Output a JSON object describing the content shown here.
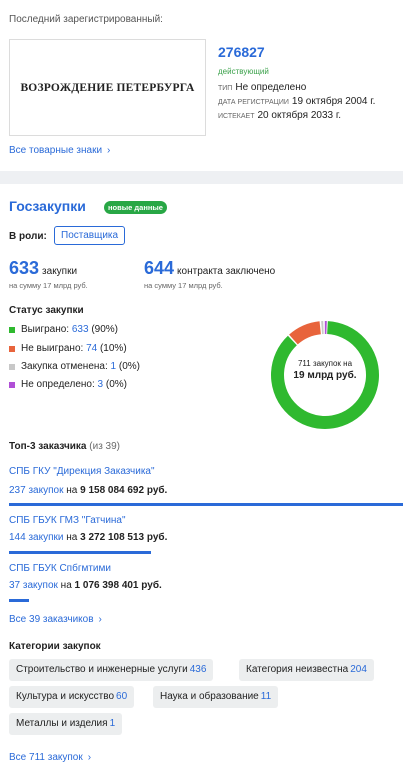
{
  "trademark": {
    "last_registered_label": "Последний зарегистрированный:",
    "image_text": "ВОЗРОЖДЕНИЕ ПЕТЕРБУРГА",
    "number": "276827",
    "status": "действующий",
    "type_label": "тип",
    "type_value": "Не определено",
    "reg_date_label": "дата регистрации",
    "reg_date_value": "19 октября 2004 г.",
    "expires_label": "истекает",
    "expires_value": "20 октября 2033 г.",
    "all_link": "Все товарные знаки",
    "chevron": "›"
  },
  "procurement": {
    "title": "Госзакупки",
    "new_badge": "новые данные",
    "role_label": "В роли:",
    "role_value": "Поставщика",
    "purchases_count": "633",
    "purchases_label": "закупки",
    "purchases_sum": "на сумму 17 млрд руб.",
    "contracts_count": "644",
    "contracts_label": "контракта заключено",
    "contracts_sum": "на сумму 17 млрд руб.",
    "status_title": "Статус закупки",
    "statuses": [
      {
        "label": "Выиграно:",
        "value": "633",
        "pct": "(90%)",
        "color": "#2fb92f",
        "count": 633
      },
      {
        "label": "Не выиграно:",
        "value": "74",
        "pct": "(10%)",
        "color": "#e8643c",
        "count": 74
      },
      {
        "label": "Закупка отменена:",
        "value": "1",
        "pct": "(0%)",
        "color": "#c8c8c8",
        "count": 1
      },
      {
        "label": "Не определено:",
        "value": "3",
        "pct": "(0%)",
        "color": "#b04fd6",
        "count": 3
      }
    ],
    "donut_line1": "711 закупок на",
    "donut_line2": "19 млрд руб.",
    "top3_title": "Топ-3 заказчика",
    "top3_of": "(из 39)",
    "customers": [
      {
        "name": "СПБ ГКУ \"Дирекция Заказчика\"",
        "count_text": "237 закупок",
        "on": "на",
        "sum": "9 158 084 692 руб.",
        "share": 1.0
      },
      {
        "name": "СПБ ГБУК ГМЗ \"Гатчина\"",
        "count_text": "144 закупки",
        "on": "на",
        "sum": "3 272 108 513 руб.",
        "share": 0.36
      },
      {
        "name": "СПБ ГБУК Спбгмтими",
        "count_text": "37 закупок",
        "on": "на",
        "sum": "1 076 398 401 руб.",
        "share": 0.05
      }
    ],
    "all_customers_link": "Все 39 заказчиков",
    "categories_title": "Категории закупок",
    "categories": [
      {
        "name": "Строительство и инженерные услуги",
        "count": "436"
      },
      {
        "name": "Категория неизвестна",
        "count": "204"
      },
      {
        "name": "Культура и искусство",
        "count": "60"
      },
      {
        "name": "Наука и образование",
        "count": "11"
      },
      {
        "name": "Металлы и изделия",
        "count": "1"
      }
    ],
    "all_purchases_link": "Все 711 закупок",
    "chevron": "›"
  }
}
